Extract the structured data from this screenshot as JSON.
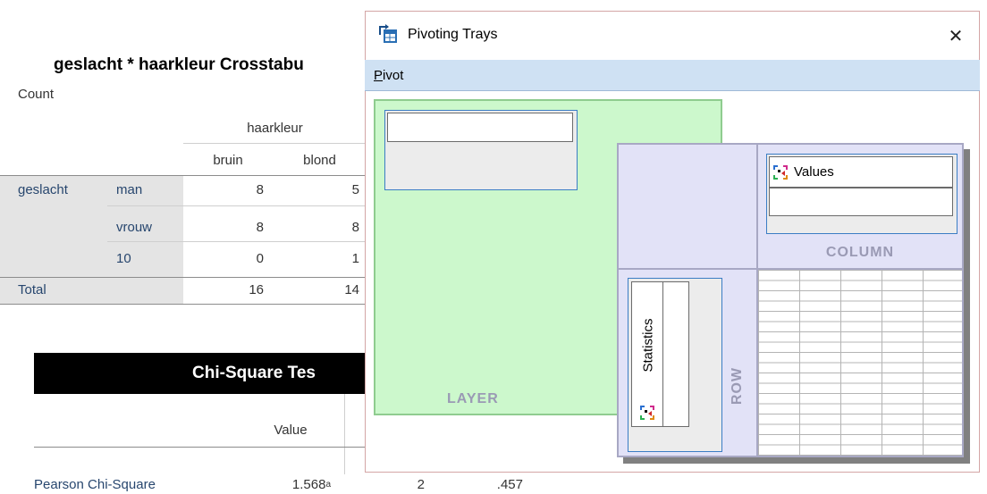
{
  "crosstab": {
    "title": "geslacht * haarkleur Crosstabu",
    "count_label": "Count",
    "col_var": "haarkleur",
    "col_headers": [
      "bruin",
      "blond"
    ],
    "row_var": "geslacht",
    "rows": [
      {
        "label": "man",
        "values": [
          "8",
          "5"
        ]
      },
      {
        "label": "vrouw",
        "values": [
          "8",
          "8"
        ]
      },
      {
        "label": "10",
        "values": [
          "0",
          "1"
        ]
      }
    ],
    "total": {
      "label": "Total",
      "values": [
        "16",
        "14"
      ]
    }
  },
  "chisq": {
    "title": "Chi-Square Tes",
    "value_header": "Value",
    "first_row": {
      "label": "Pearson Chi-Square",
      "value": "1.568",
      "footnote": "a",
      "df": "2",
      "sig": ".457"
    }
  },
  "dialog": {
    "title": "Pivoting Trays",
    "close_glyph": "✕",
    "menu": {
      "pivot_prefix": "P",
      "pivot_rest": "ivot"
    },
    "trays": {
      "layer_label": "LAYER",
      "column_label": "COLUMN",
      "row_label": "ROW",
      "column_item": "Values",
      "row_item": "Statistics"
    }
  },
  "colors": {
    "layer_fill": "#ccf8cc",
    "layer_border": "#8fcc8f",
    "tray_fill": "#e2e2f7",
    "chip_border": "#3b7dc4",
    "menu_bar": "#cfe1f3"
  },
  "icons": {
    "app": "pivot-table-icon",
    "pivot_item": "pivot-item-icon",
    "close": "close-icon"
  }
}
